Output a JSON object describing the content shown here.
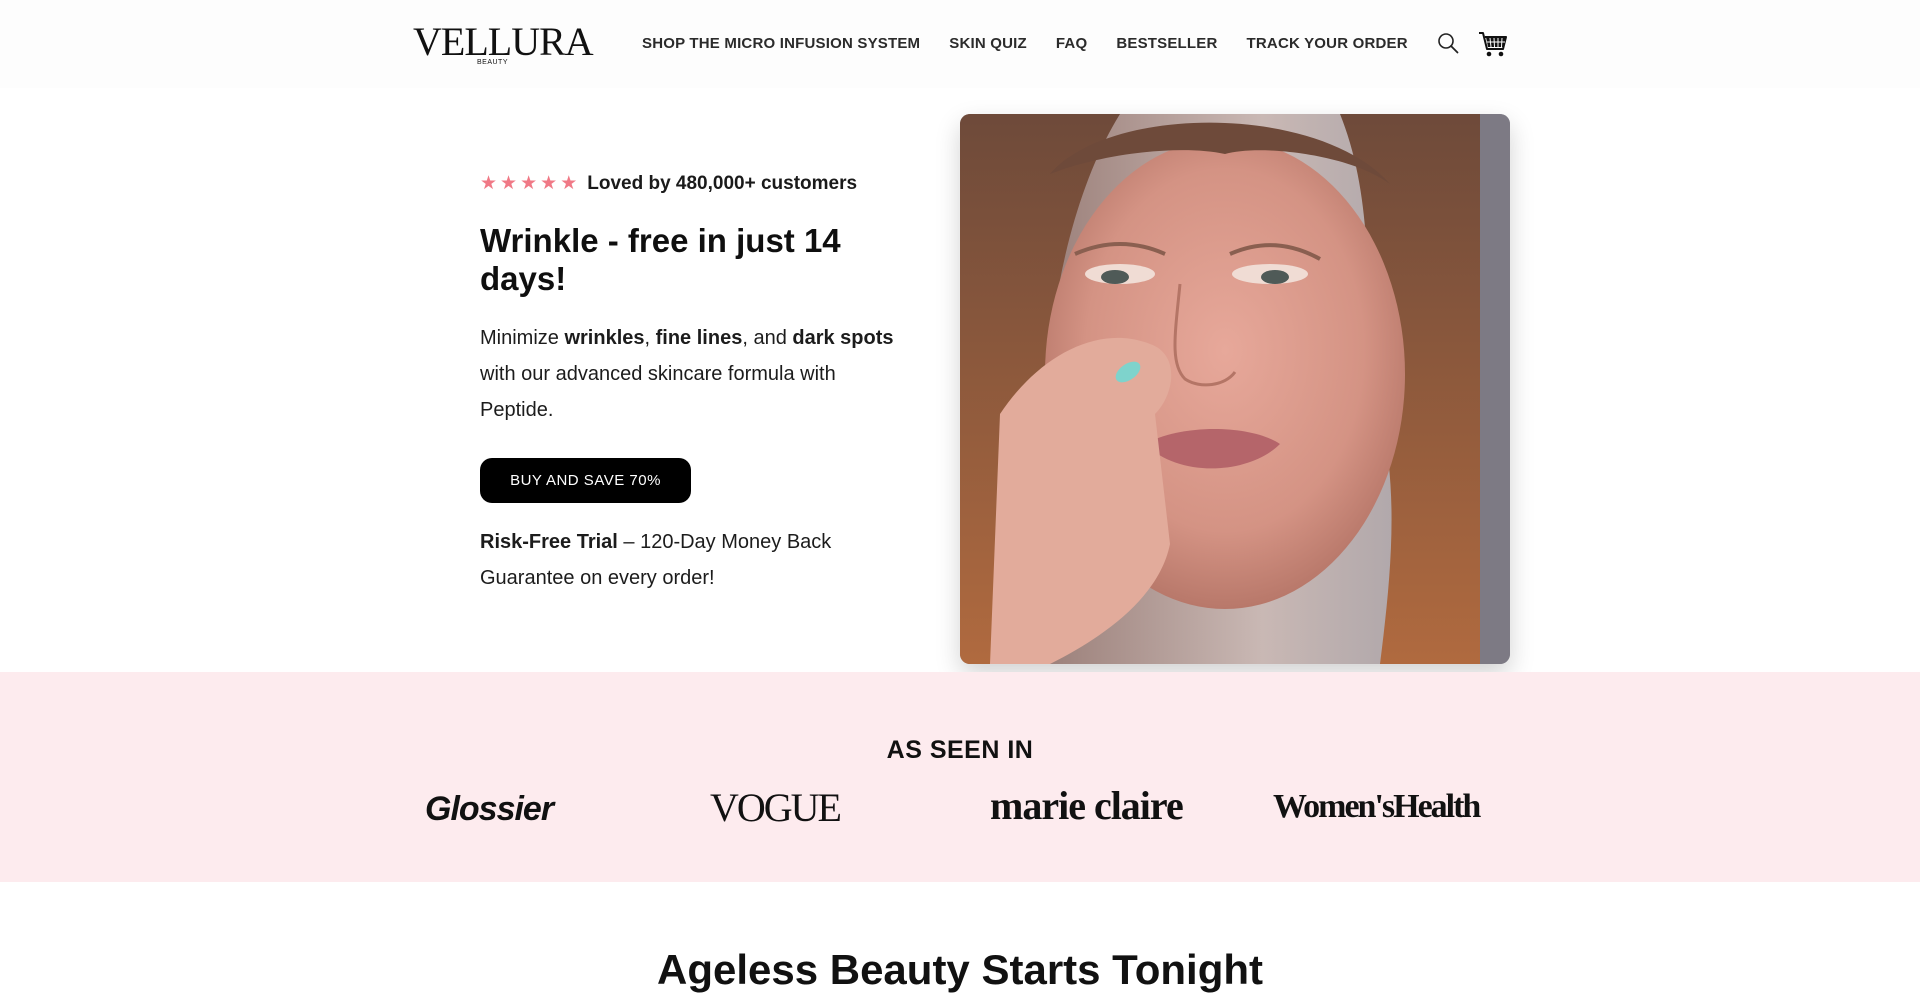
{
  "header": {
    "logo": {
      "main": "VELLURA",
      "sub": "BEAUTY"
    },
    "nav": [
      {
        "label": "SHOP THE MICRO INFUSION SYSTEM"
      },
      {
        "label": "SKIN QUIZ"
      },
      {
        "label": "FAQ"
      },
      {
        "label": "BESTSELLER"
      },
      {
        "label": "TRACK YOUR ORDER"
      }
    ],
    "icons": {
      "search": "search-icon",
      "cart": "cart-icon"
    }
  },
  "hero": {
    "rating": {
      "stars": 5,
      "text": "Loved by 480,000+ customers",
      "star_color": "#f07986"
    },
    "title": "Wrinkle - free in just 14 days!",
    "description": {
      "t1": "Minimize ",
      "b1": "wrinkles",
      "t2": ", ",
      "b2": "fine lines",
      "t3": ", and ",
      "b3": "dark spots",
      "t4": " with our advanced skincare formula with Peptide."
    },
    "cta_label": "BUY AND SAVE 70%",
    "guarantee": {
      "bold": "Risk-Free Trial",
      "rest": " – 120-Day Money Back Guarantee on every order!"
    }
  },
  "press": {
    "title": "AS SEEN IN",
    "logos": [
      "Glossier",
      "VOGUE",
      "marie claire",
      "Women'sHealth"
    ],
    "background": "#fdebee"
  },
  "next_section": {
    "title": "Ageless Beauty Starts Tonight"
  }
}
